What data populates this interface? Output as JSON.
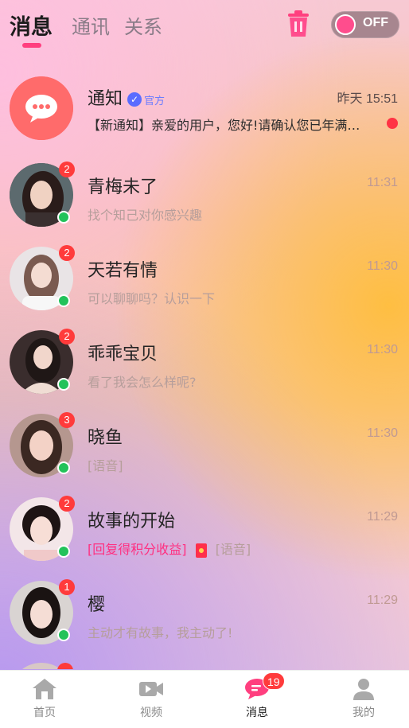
{
  "header": {
    "tabs": [
      {
        "label": "消息",
        "active": true
      },
      {
        "label": "通讯",
        "active": false
      },
      {
        "label": "关系",
        "active": false
      }
    ],
    "toggle_label": "OFF",
    "icons": {
      "trash": "trash-icon",
      "toggle": "toggle-switch"
    }
  },
  "notification": {
    "name": "通知",
    "verified_mark": "✓",
    "official_label": "官方",
    "time": "昨天 15:51",
    "message": "【新通知】亲爱的用户，您好!请确认您已年满…",
    "icon": "chat-bubble-icon",
    "unread_dot_color": "#ff3344"
  },
  "conversations": [
    {
      "name": "青梅未了",
      "time": "11:31",
      "message": "找个知己对你感兴趣",
      "badge": "2",
      "online": true
    },
    {
      "name": "天若有情",
      "time": "11:30",
      "message": "可以聊聊吗？认识一下",
      "badge": "2",
      "online": true
    },
    {
      "name": "乖乖宝贝",
      "time": "11:30",
      "message": "看了我会怎么样呢?",
      "badge": "2",
      "online": true
    },
    {
      "name": "晓鱼",
      "time": "11:30",
      "message": "[语音]",
      "badge": "3",
      "online": true
    },
    {
      "name": "故事的开始",
      "time": "11:29",
      "message_highlight": "[回复得积分收益]",
      "message_extra": "[语音]",
      "badge": "2",
      "online": true
    },
    {
      "name": "樱",
      "time": "11:29",
      "message": "主动才有故事，我主动了!",
      "badge": "1",
      "online": true
    }
  ],
  "bottom_nav": {
    "items": [
      {
        "label": "首页",
        "icon": "home-icon"
      },
      {
        "label": "视频",
        "icon": "video-icon"
      },
      {
        "label": "消息",
        "icon": "message-icon",
        "badge": "19",
        "active": true
      },
      {
        "label": "我的",
        "icon": "profile-icon"
      }
    ]
  },
  "colors": {
    "accent": "#ff3f7f",
    "badge": "#ff3b3b",
    "online": "#22c25a"
  }
}
